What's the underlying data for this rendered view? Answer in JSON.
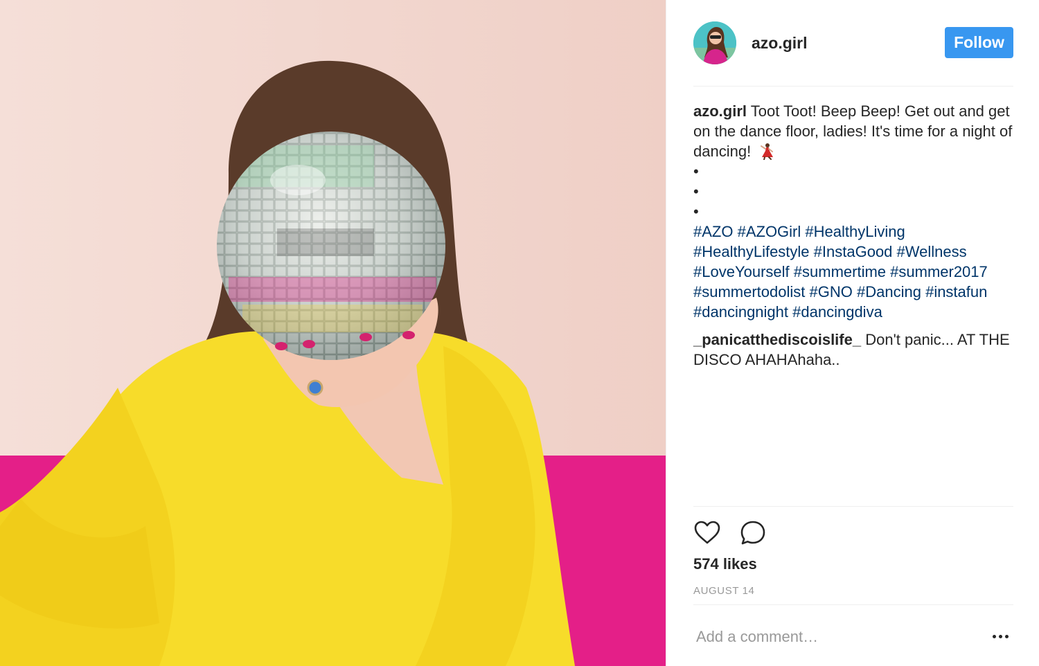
{
  "post": {
    "author": "azo.girl",
    "follow_label": "Follow",
    "photo_alt": "Woman in yellow dress holding a disco ball in front of her face",
    "avatar_alt": "azo.girl profile picture"
  },
  "caption": {
    "author": "azo.girl",
    "text": "Toot Toot! Beep Beep! Get out and get on the dance floor, ladies! It's time for a night of dancing!",
    "emoji": "dancer-emoji",
    "bullets": [
      "•",
      "•",
      "•"
    ],
    "hashtags": [
      "#AZO",
      "#AZOGirl",
      "#HealthyLiving",
      "#HealthyLifestyle",
      "#InstaGood",
      "#Wellness",
      "#LoveYourself",
      "#summertime",
      "#summer2017",
      "#summertodolist",
      "#GNO",
      "#Dancing",
      "#instafun",
      "#dancingnight",
      "#dancingdiva"
    ]
  },
  "comments": [
    {
      "author": "_panicatthediscoislife_",
      "text": "Don't panic... AT THE DISCO AHAHAhaha.."
    }
  ],
  "stats": {
    "likes": "574 likes",
    "date": "AUGUST 14"
  },
  "add_comment": {
    "placeholder": "Add a comment…"
  },
  "icons": {
    "like": "heart-icon",
    "comment": "comment-bubble-icon",
    "more": "more-options-icon"
  },
  "colors": {
    "follow_button": "#3897f0",
    "hashtag": "#003569",
    "muted": "#999999",
    "divider": "#efefef"
  }
}
